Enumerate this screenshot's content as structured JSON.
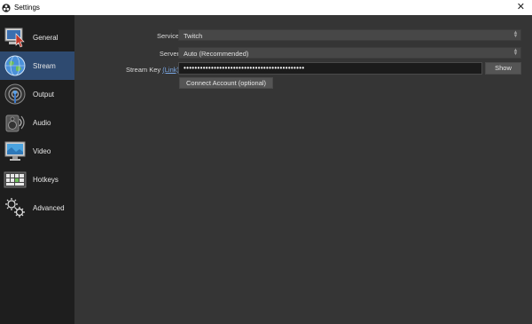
{
  "window": {
    "title": "Settings",
    "close_glyph": "✕"
  },
  "sidebar": {
    "items": [
      {
        "label": "General",
        "icon": "monitor-cursor-icon"
      },
      {
        "label": "Stream",
        "icon": "globe-icon",
        "active": true
      },
      {
        "label": "Output",
        "icon": "broadcast-icon"
      },
      {
        "label": "Audio",
        "icon": "speaker-icon"
      },
      {
        "label": "Video",
        "icon": "display-icon"
      },
      {
        "label": "Hotkeys",
        "icon": "keyboard-icon"
      },
      {
        "label": "Advanced",
        "icon": "gears-icon"
      }
    ]
  },
  "stream": {
    "service_label": "Service",
    "service_value": "Twitch",
    "server_label": "Server",
    "server_value": "Auto (Recommended)",
    "key_label": "Stream Key",
    "key_link": "(Link)",
    "key_value": "••••••••••••••••••••••••••••••••••••••••••••",
    "show_button": "Show",
    "connect_button": "Connect Account (optional)"
  },
  "colors": {
    "active": "#2e4a70",
    "sidebar_bg": "#1e1e1e",
    "main_bg": "#353535",
    "link": "#7aa8e6"
  }
}
